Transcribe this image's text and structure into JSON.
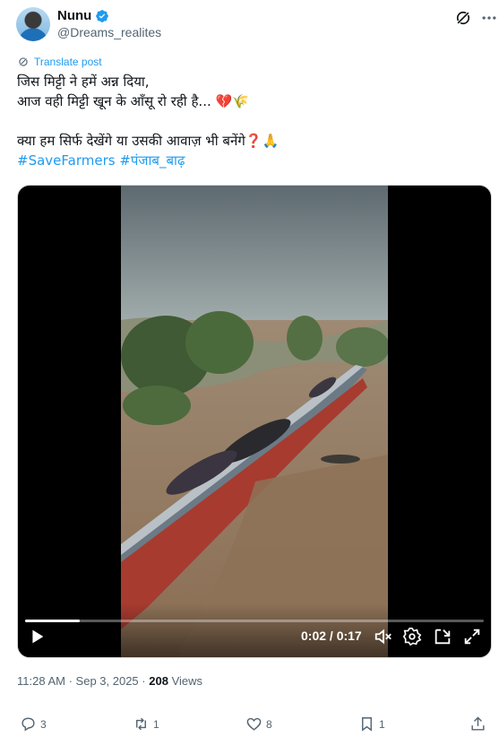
{
  "author": {
    "name": "Nunu",
    "handle": "@Dreams_realites"
  },
  "translate_label": "Translate post",
  "text_lines": [
    "जिस मिट्टी ने हमें अन्न दिया,",
    "आज वही मिट्टी खून के आँसू रो रही है... 💔🌾",
    "क्या हम सिर्फ देखेंगे या उसकी आवाज़ भी बनेंगे❓🙏"
  ],
  "hashtags": "#SaveFarmers #पंजाब_बाढ़",
  "video": {
    "time_display": "0:02 / 0:17",
    "progress": 0.12
  },
  "meta": {
    "time": "11:28 AM",
    "date": "Sep 3, 2025",
    "views_count": "208",
    "views_label": "Views"
  },
  "actions": {
    "replies": "3",
    "reposts": "1",
    "likes": "8",
    "bookmarks": "1"
  },
  "colors": {
    "accent": "#1d9bf0",
    "secondary_text": "#536471"
  }
}
